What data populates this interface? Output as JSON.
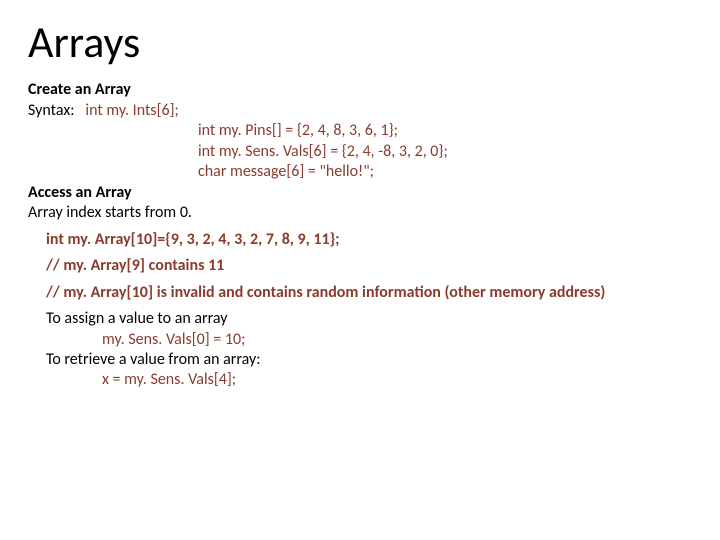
{
  "title": "Arrays",
  "section1": {
    "heading": "Create an Array",
    "syntax_label": "Syntax:",
    "syntax_code": "int my. Ints[6];",
    "examples": [
      "int my. Pins[] = {2, 4, 8, 3, 6, 1};",
      "int my. Sens. Vals[6] = {2, 4, -8, 3, 2, 0};",
      "char message[6] = \"hello!\";"
    ]
  },
  "section2": {
    "heading": "Access an Array",
    "note": "Array index starts from 0."
  },
  "code": {
    "decl": "int my. Array[10]={9, 3, 2, 4, 3, 2, 7, 8, 9, 11};",
    "comment1": "// my. Array[9] contains 11",
    "comment2": "// my. Array[10] is invalid and contains random information (other memory address)"
  },
  "assign": {
    "heading": "To assign a value to an array",
    "line": "my. Sens. Vals[0] = 10;"
  },
  "retrieve": {
    "heading": "To retrieve a value from an array:",
    "line": "x = my. Sens. Vals[4];"
  }
}
